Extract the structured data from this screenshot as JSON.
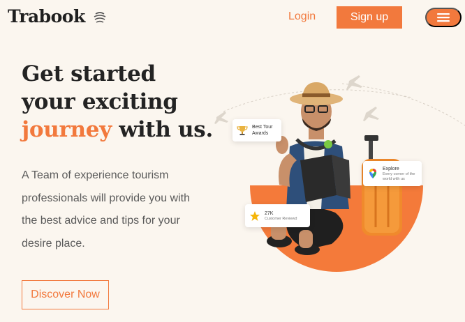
{
  "nav": {
    "brand": "Trabook",
    "login_label": "Login",
    "signup_label": "Sign up"
  },
  "hero": {
    "title_line1": "Get started",
    "title_line2": "your exciting",
    "title_accent": "journey",
    "title_rest": " with us.",
    "description": "A Team of experience tourism professionals will provide you with the best advice and tips for your desire place.",
    "cta_label": "Discover Now"
  },
  "cards": {
    "awards": {
      "line1": "Best Tour",
      "line2": "Awards"
    },
    "explore": {
      "title": "Explore",
      "subtitle": "Every corner of the world with us"
    },
    "reviews": {
      "title": "27K",
      "subtitle": "Customer Reviewd"
    }
  },
  "icons": {
    "logo": "stacked-lines-icon",
    "menu": "hamburger-icon",
    "awards": "trophy-icon",
    "explore": "map-pin-icon",
    "reviews": "star-icon"
  },
  "colors": {
    "accent": "#f2793d",
    "background": "#fbf6ef",
    "heading": "#232323",
    "body_text": "#5a5a5a"
  }
}
